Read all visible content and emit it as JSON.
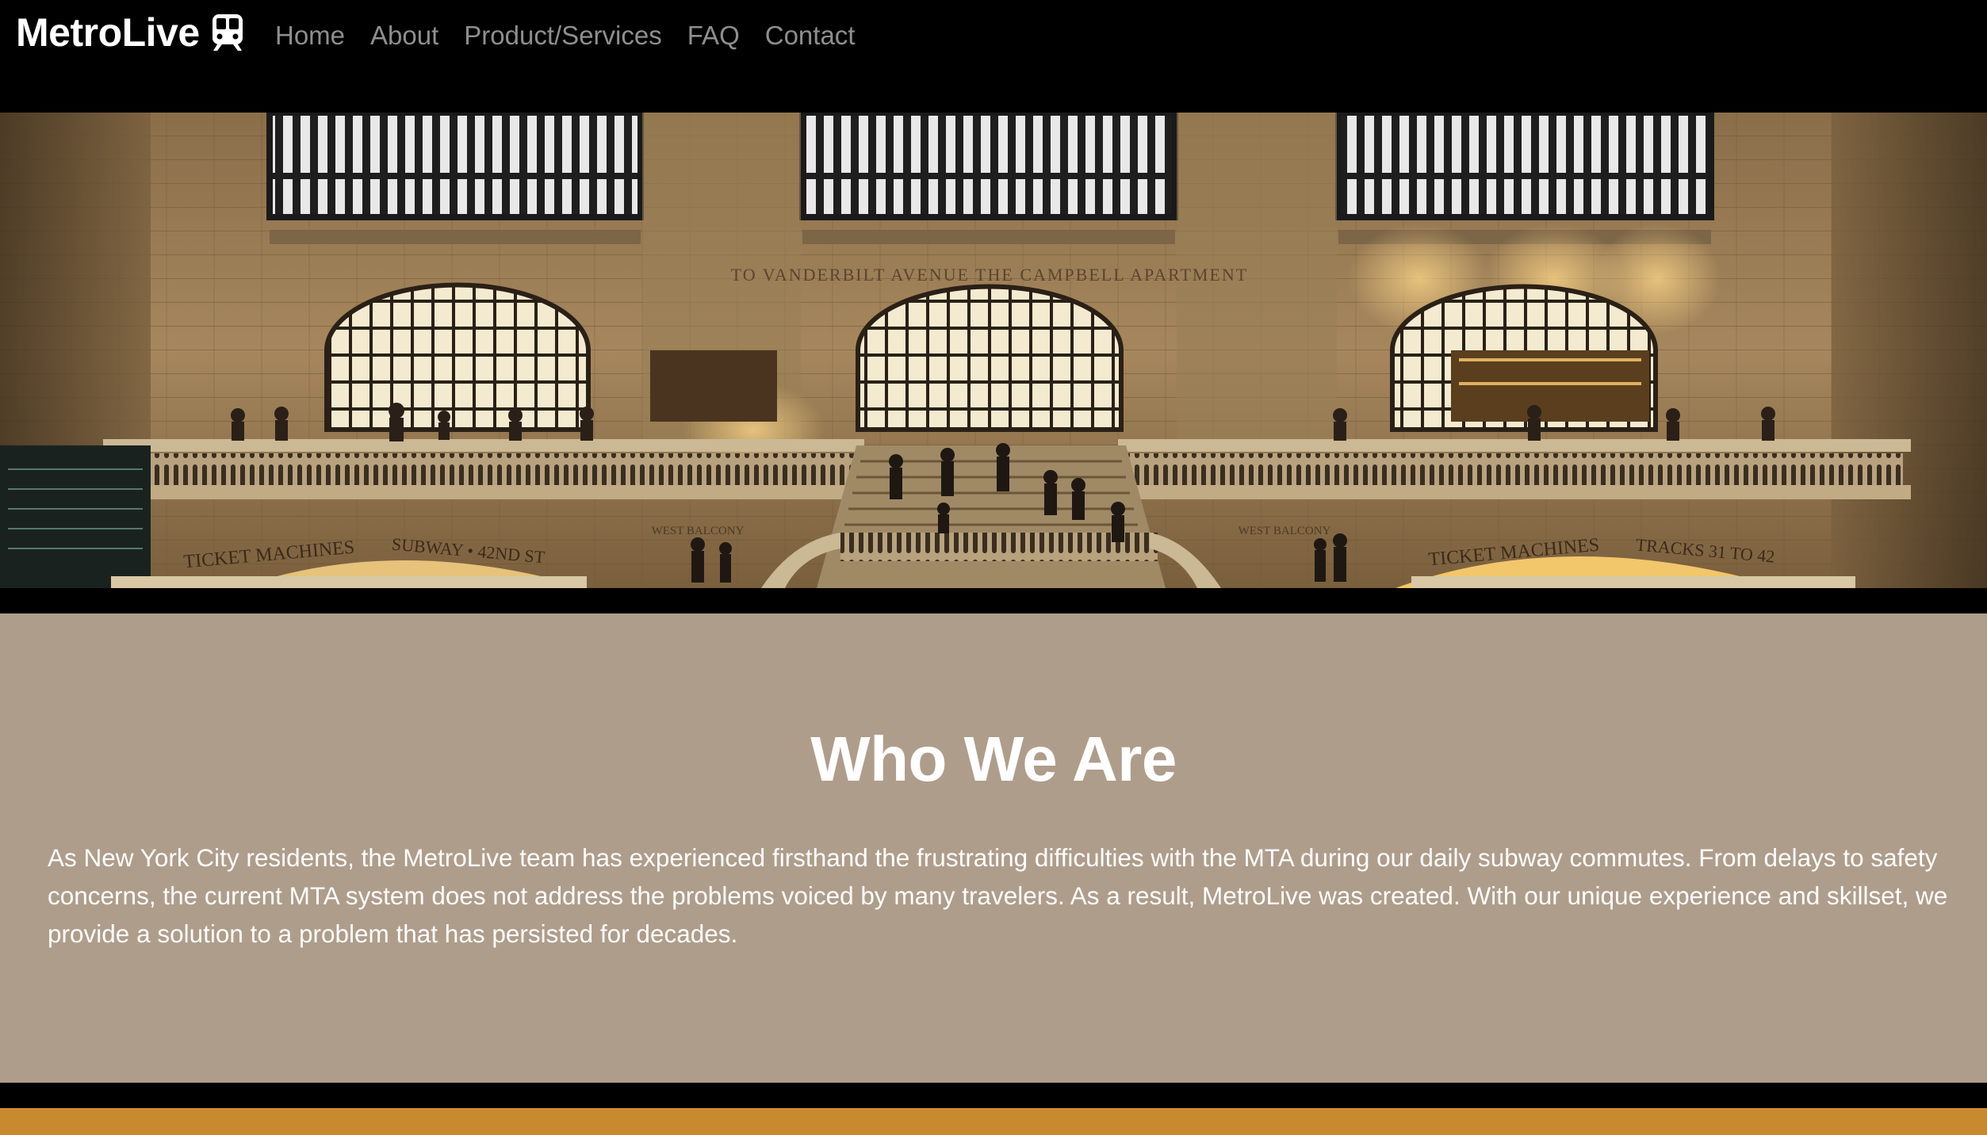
{
  "brand": {
    "name": "MetroLive",
    "icon": "train-icon"
  },
  "nav": {
    "items": [
      {
        "label": "Home"
      },
      {
        "label": "About"
      },
      {
        "label": "Product/Services"
      },
      {
        "label": "FAQ"
      },
      {
        "label": "Contact"
      }
    ]
  },
  "about": {
    "title": "Who We Are",
    "body": "As New York City residents, the MetroLive team has experienced firsthand the frustrating difficulties with the MTA during our daily subway commutes. From delays to safety concerns, the current MTA system does not address the problems voiced by many travelers. As a result, MetroLive was created. With our unique experience and skillset, we provide a solution to a problem that has persisted for decades."
  },
  "hero": {
    "signs": {
      "center_arch": "TO VANDERBILT AVENUE THE CAMPBELL APARTMENT",
      "ticket_machines_left": "TICKET MACHINES",
      "subway": "SUBWAY • 42ND ST",
      "west_balcony_left": "WEST BALCONY",
      "west_balcony_right": "WEST BALCONY",
      "ticket_machines_right": "TICKET MACHINES",
      "tracks": "TRACKS 31 TO 42"
    }
  },
  "colors": {
    "navbar_bg": "#000000",
    "nav_link": "#8e8e8e",
    "about_bg": "#af9d8b",
    "next_section_bg": "#c98a2f"
  }
}
